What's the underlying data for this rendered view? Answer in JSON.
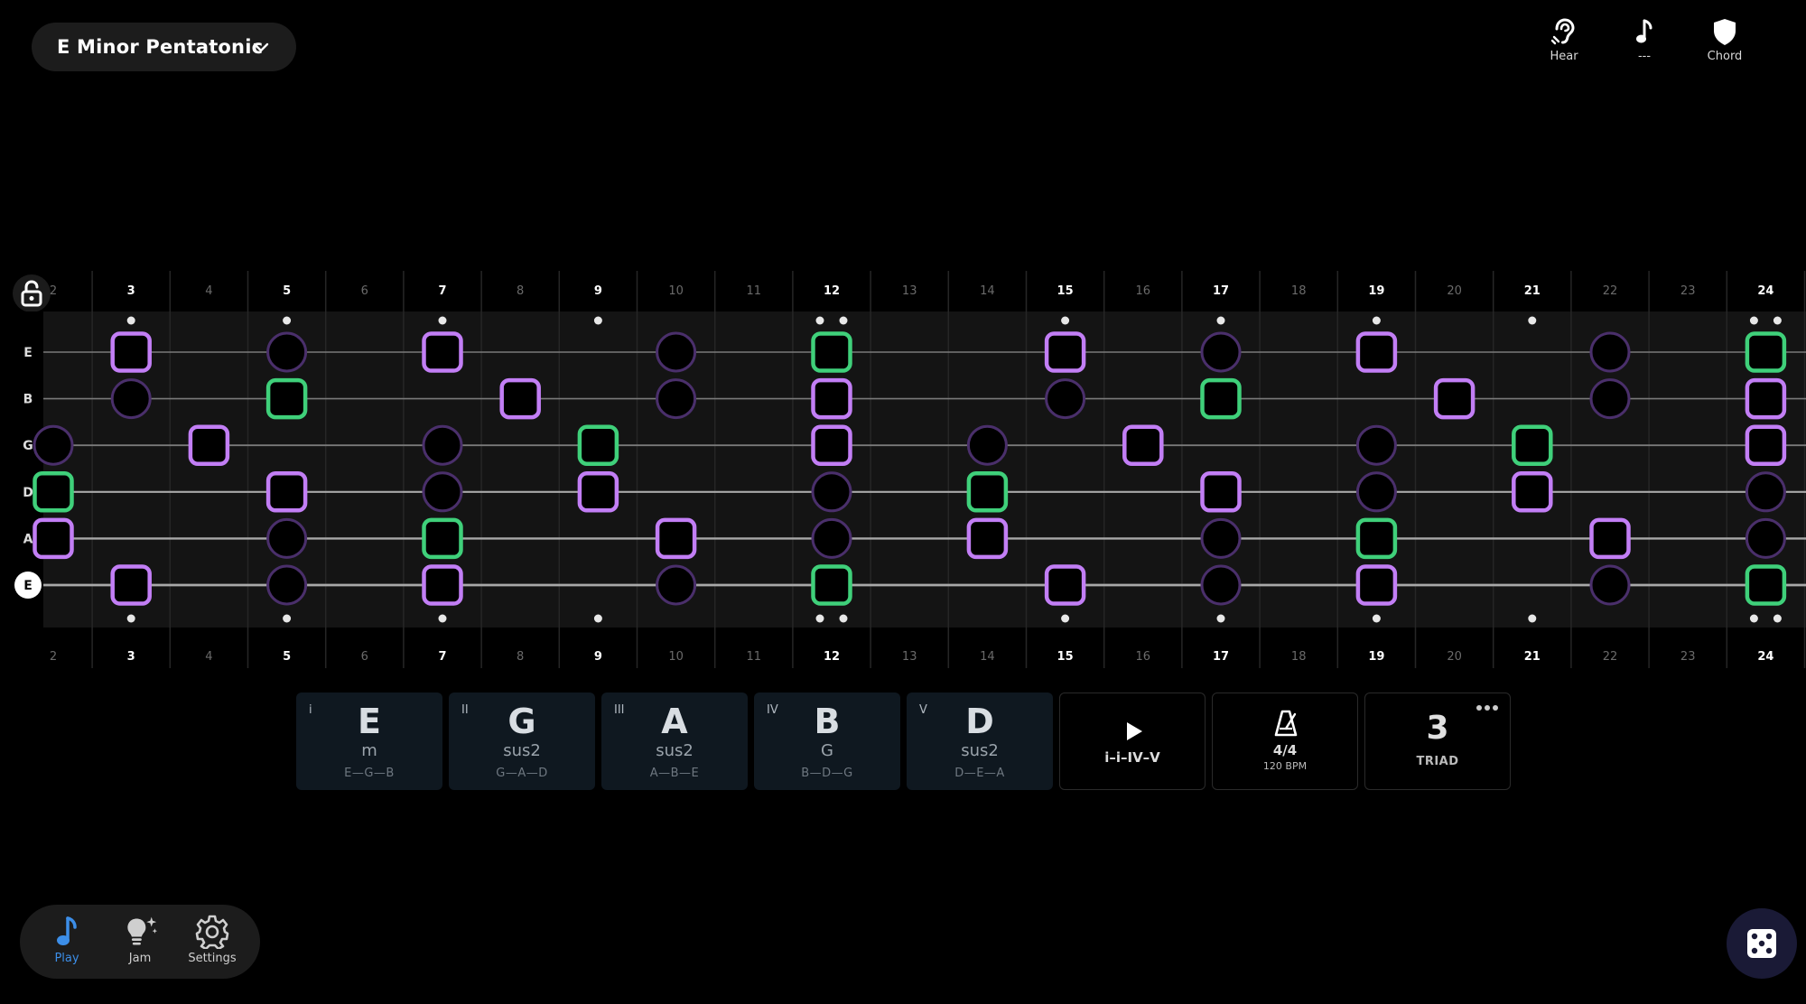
{
  "scale_selector": {
    "label": "E Minor Pentatonic",
    "chevron_icon": "chevron-down-icon"
  },
  "top_actions": [
    {
      "label": "Hear",
      "icon": "ear-icon"
    },
    {
      "label": "---",
      "icon": "music-note-icon"
    },
    {
      "label": "Chord",
      "icon": "shield-icon"
    }
  ],
  "fretboard": {
    "lock_icon": "lock-open-icon",
    "frets": [
      2,
      3,
      4,
      5,
      6,
      7,
      8,
      9,
      10,
      11,
      12,
      13,
      14,
      15,
      16,
      17,
      18,
      19,
      20,
      21,
      22,
      23,
      24
    ],
    "bold_frets": [
      3,
      5,
      7,
      9,
      12,
      15,
      17,
      19,
      21,
      24
    ],
    "strings": [
      "E",
      "B",
      "G",
      "D",
      "A",
      "E"
    ],
    "highlighted_string": 5,
    "inlay_single": [
      3,
      5,
      7,
      9,
      15,
      17,
      19,
      21
    ],
    "inlay_double": [
      12,
      24
    ],
    "markers": [
      {
        "s": 0,
        "f": 3,
        "t": "square"
      },
      {
        "s": 0,
        "f": 5,
        "t": "circle"
      },
      {
        "s": 0,
        "f": 7,
        "t": "square"
      },
      {
        "s": 0,
        "f": 10,
        "t": "circle"
      },
      {
        "s": 0,
        "f": 12,
        "t": "root"
      },
      {
        "s": 0,
        "f": 15,
        "t": "square"
      },
      {
        "s": 0,
        "f": 17,
        "t": "circle"
      },
      {
        "s": 0,
        "f": 19,
        "t": "square"
      },
      {
        "s": 0,
        "f": 22,
        "t": "circle"
      },
      {
        "s": 0,
        "f": 24,
        "t": "root"
      },
      {
        "s": 1,
        "f": 3,
        "t": "circle"
      },
      {
        "s": 1,
        "f": 5,
        "t": "root"
      },
      {
        "s": 1,
        "f": 8,
        "t": "square"
      },
      {
        "s": 1,
        "f": 10,
        "t": "circle"
      },
      {
        "s": 1,
        "f": 12,
        "t": "square"
      },
      {
        "s": 1,
        "f": 15,
        "t": "circle"
      },
      {
        "s": 1,
        "f": 17,
        "t": "root"
      },
      {
        "s": 1,
        "f": 20,
        "t": "square"
      },
      {
        "s": 1,
        "f": 22,
        "t": "circle"
      },
      {
        "s": 1,
        "f": 24,
        "t": "square"
      },
      {
        "s": 2,
        "f": 2,
        "t": "circle"
      },
      {
        "s": 2,
        "f": 4,
        "t": "square"
      },
      {
        "s": 2,
        "f": 7,
        "t": "circle"
      },
      {
        "s": 2,
        "f": 9,
        "t": "root"
      },
      {
        "s": 2,
        "f": 12,
        "t": "square"
      },
      {
        "s": 2,
        "f": 14,
        "t": "circle"
      },
      {
        "s": 2,
        "f": 16,
        "t": "square"
      },
      {
        "s": 2,
        "f": 19,
        "t": "circle"
      },
      {
        "s": 2,
        "f": 21,
        "t": "root"
      },
      {
        "s": 2,
        "f": 24,
        "t": "square"
      },
      {
        "s": 3,
        "f": 2,
        "t": "root"
      },
      {
        "s": 3,
        "f": 5,
        "t": "square"
      },
      {
        "s": 3,
        "f": 7,
        "t": "circle"
      },
      {
        "s": 3,
        "f": 9,
        "t": "square"
      },
      {
        "s": 3,
        "f": 12,
        "t": "circle"
      },
      {
        "s": 3,
        "f": 14,
        "t": "root"
      },
      {
        "s": 3,
        "f": 17,
        "t": "square"
      },
      {
        "s": 3,
        "f": 19,
        "t": "circle"
      },
      {
        "s": 3,
        "f": 21,
        "t": "square"
      },
      {
        "s": 3,
        "f": 24,
        "t": "circle"
      },
      {
        "s": 4,
        "f": 2,
        "t": "square"
      },
      {
        "s": 4,
        "f": 5,
        "t": "circle"
      },
      {
        "s": 4,
        "f": 7,
        "t": "root"
      },
      {
        "s": 4,
        "f": 10,
        "t": "square"
      },
      {
        "s": 4,
        "f": 12,
        "t": "circle"
      },
      {
        "s": 4,
        "f": 14,
        "t": "square"
      },
      {
        "s": 4,
        "f": 17,
        "t": "circle"
      },
      {
        "s": 4,
        "f": 19,
        "t": "root"
      },
      {
        "s": 4,
        "f": 22,
        "t": "square"
      },
      {
        "s": 4,
        "f": 24,
        "t": "circle"
      },
      {
        "s": 5,
        "f": 3,
        "t": "square"
      },
      {
        "s": 5,
        "f": 5,
        "t": "circle"
      },
      {
        "s": 5,
        "f": 7,
        "t": "square"
      },
      {
        "s": 5,
        "f": 10,
        "t": "circle"
      },
      {
        "s": 5,
        "f": 12,
        "t": "root"
      },
      {
        "s": 5,
        "f": 15,
        "t": "square"
      },
      {
        "s": 5,
        "f": 17,
        "t": "circle"
      },
      {
        "s": 5,
        "f": 19,
        "t": "square"
      },
      {
        "s": 5,
        "f": 22,
        "t": "circle"
      },
      {
        "s": 5,
        "f": 24,
        "t": "root"
      }
    ],
    "colors": {
      "purple": "#c27ef5",
      "green": "#3fd07a",
      "circle_stroke": "#4a2f6b",
      "bg": "#141414"
    }
  },
  "chords": [
    {
      "numeral": "i",
      "root": "E",
      "quality": "m",
      "notes": "E—G—B"
    },
    {
      "numeral": "II",
      "root": "G",
      "quality": "sus2",
      "notes": "G—A—D"
    },
    {
      "numeral": "III",
      "root": "A",
      "quality": "sus2",
      "notes": "A—B—E"
    },
    {
      "numeral": "IV",
      "root": "B",
      "quality": "G",
      "notes": "B—D—G"
    },
    {
      "numeral": "V",
      "root": "D",
      "quality": "sus2",
      "notes": "D—E—A"
    }
  ],
  "controls": {
    "progression": {
      "label": "i–i–IV–V",
      "icon": "play-icon"
    },
    "metronome": {
      "time_signature": "4/4",
      "bpm": "120 BPM",
      "icon": "metronome-icon"
    },
    "voicing": {
      "value": "3",
      "label": "TRIAD",
      "icon": "more-icon"
    }
  },
  "bottom_nav": [
    {
      "label": "Play",
      "icon": "music-note-icon",
      "active": true
    },
    {
      "label": "Jam",
      "icon": "lightbulb-icon",
      "active": false
    },
    {
      "label": "Settings",
      "icon": "gear-icon",
      "active": false
    }
  ],
  "dice_icon": "dice-icon"
}
